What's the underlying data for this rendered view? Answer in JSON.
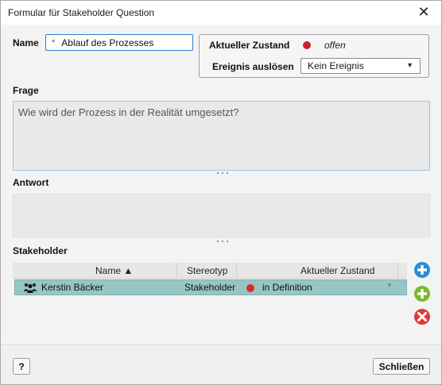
{
  "window": {
    "title": "Formular für Stakeholder Question"
  },
  "name": {
    "label": "Name",
    "required_mark": "*",
    "value": "Ablauf des Prozesses"
  },
  "state": {
    "current_label": "Aktueller Zustand",
    "current_value": "offen",
    "current_color": "#c8232b",
    "event_label": "Ereignis auslösen",
    "event_value": "Kein Ereignis"
  },
  "frage": {
    "label": "Frage",
    "value": "Wie wird der Prozess in der Realität umgesetzt?"
  },
  "antwort": {
    "label": "Antwort",
    "value": ""
  },
  "stakeholder": {
    "label": "Stakeholder",
    "columns": [
      "Name ▲",
      "Stereotyp",
      "Aktueller Zustand"
    ],
    "rows": [
      {
        "name": "Kerstin Bäcker",
        "stereotype": "Stakeholder",
        "state": "in Definition",
        "state_color": "#e02828"
      }
    ],
    "selected_row_color": "#97c5c5",
    "actions": [
      "add-icon",
      "add-new-icon",
      "remove-icon"
    ]
  },
  "footer": {
    "help_label": "?",
    "close_label": "Schließen"
  }
}
